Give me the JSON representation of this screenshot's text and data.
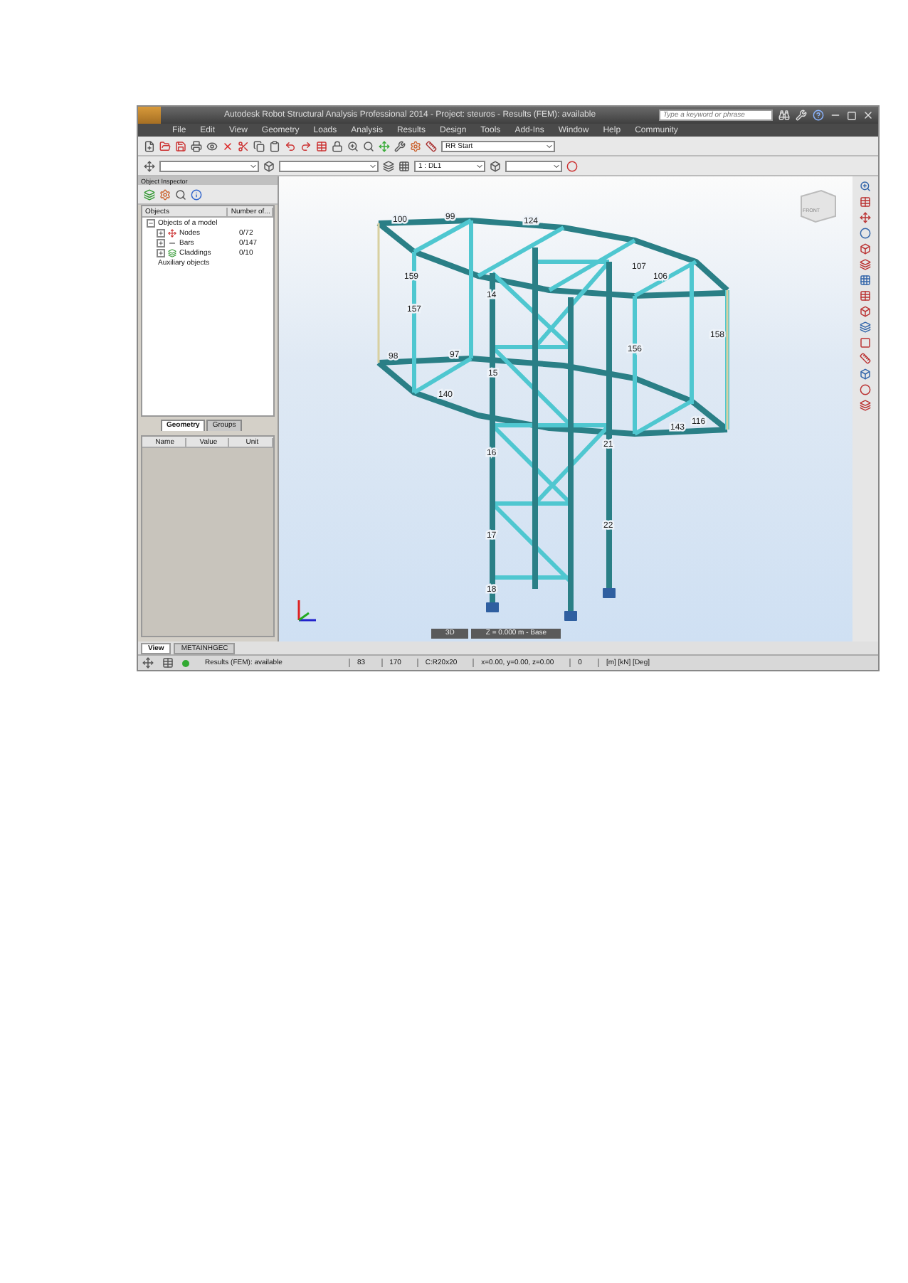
{
  "window": {
    "title": "Autodesk Robot Structural Analysis Professional 2014 - Project: steuros - Results (FEM): available",
    "search": {
      "placeholder": "Type a keyword or phrase"
    }
  },
  "menu": [
    "File",
    "Edit",
    "View",
    "Geometry",
    "Loads",
    "Analysis",
    "Results",
    "Design",
    "Tools",
    "Add-Ins",
    "Window",
    "Help",
    "Community"
  ],
  "toolbar": {
    "layout_dropdown": "RR Start",
    "case_dropdown": "1 : DL1"
  },
  "inspector": {
    "title": "Object Inspector",
    "columns": [
      "Objects",
      "Number of..."
    ],
    "tree": [
      {
        "label": "Objects of a model",
        "expanded": true,
        "children": [
          {
            "label": "Nodes",
            "count": "0/72",
            "kind": "node"
          },
          {
            "label": "Bars",
            "count": "0/147",
            "kind": "bar"
          },
          {
            "label": "Claddings",
            "count": "0/10",
            "kind": "cladding"
          }
        ]
      },
      {
        "label": "Auxiliary objects"
      }
    ],
    "tabs": [
      {
        "label": "Geometry",
        "selected": true
      },
      {
        "label": "Groups",
        "selected": false
      }
    ],
    "property_columns": [
      "Name",
      "Value",
      "Unit"
    ]
  },
  "view": {
    "cube_label": "FRONT",
    "mode": "3D",
    "level": "Z = 0.000 m - Base",
    "bar_labels": [
      "100",
      "99",
      "124",
      "159",
      "157",
      "14",
      "15",
      "16",
      "17",
      "18",
      "158",
      "156",
      "98",
      "97",
      "107",
      "106",
      "143",
      "116",
      "140",
      "21",
      "22"
    ]
  },
  "bottom_tabs": [
    {
      "label": "View",
      "selected": true
    },
    {
      "label": "METAINHGEC",
      "selected": false
    }
  ],
  "status_bar": {
    "message": "Results (FEM): available",
    "fields": [
      "83",
      "170",
      "C:R20x20",
      "x=0.00, y=0.00, z=0.00",
      "0",
      "[m] [kN] [Deg]"
    ]
  }
}
